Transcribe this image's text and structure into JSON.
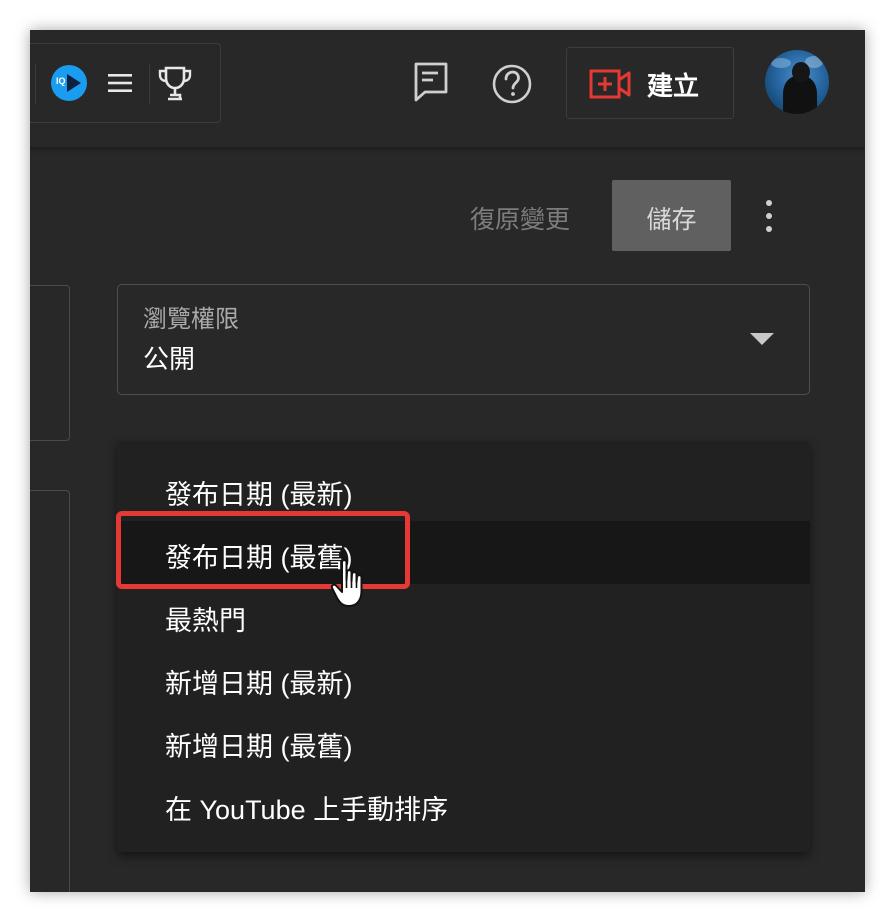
{
  "header": {
    "create_label": "建立",
    "icons": [
      "vidiq-icon",
      "menu-icon",
      "trophy-icon",
      "feedback-icon",
      "help-icon",
      "create-video-icon",
      "avatar"
    ],
    "vidiq_badge": "IQ"
  },
  "actions": {
    "undo_label": "復原變更",
    "save_label": "儲存"
  },
  "visibility": {
    "label": "瀏覽權限",
    "value": "公開"
  },
  "sort_menu": {
    "items": [
      "發布日期 (最新)",
      "發布日期 (最舊)",
      "最熱門",
      "新增日期 (最新)",
      "新增日期 (最舊)",
      "在 YouTube 上手動排序"
    ],
    "hovered_index": 1
  },
  "colors": {
    "background": "#282828",
    "menu_background": "#212121",
    "highlight": "#e53935",
    "accent_red": "#e53935",
    "vidiq_blue": "#1a9cf0"
  }
}
